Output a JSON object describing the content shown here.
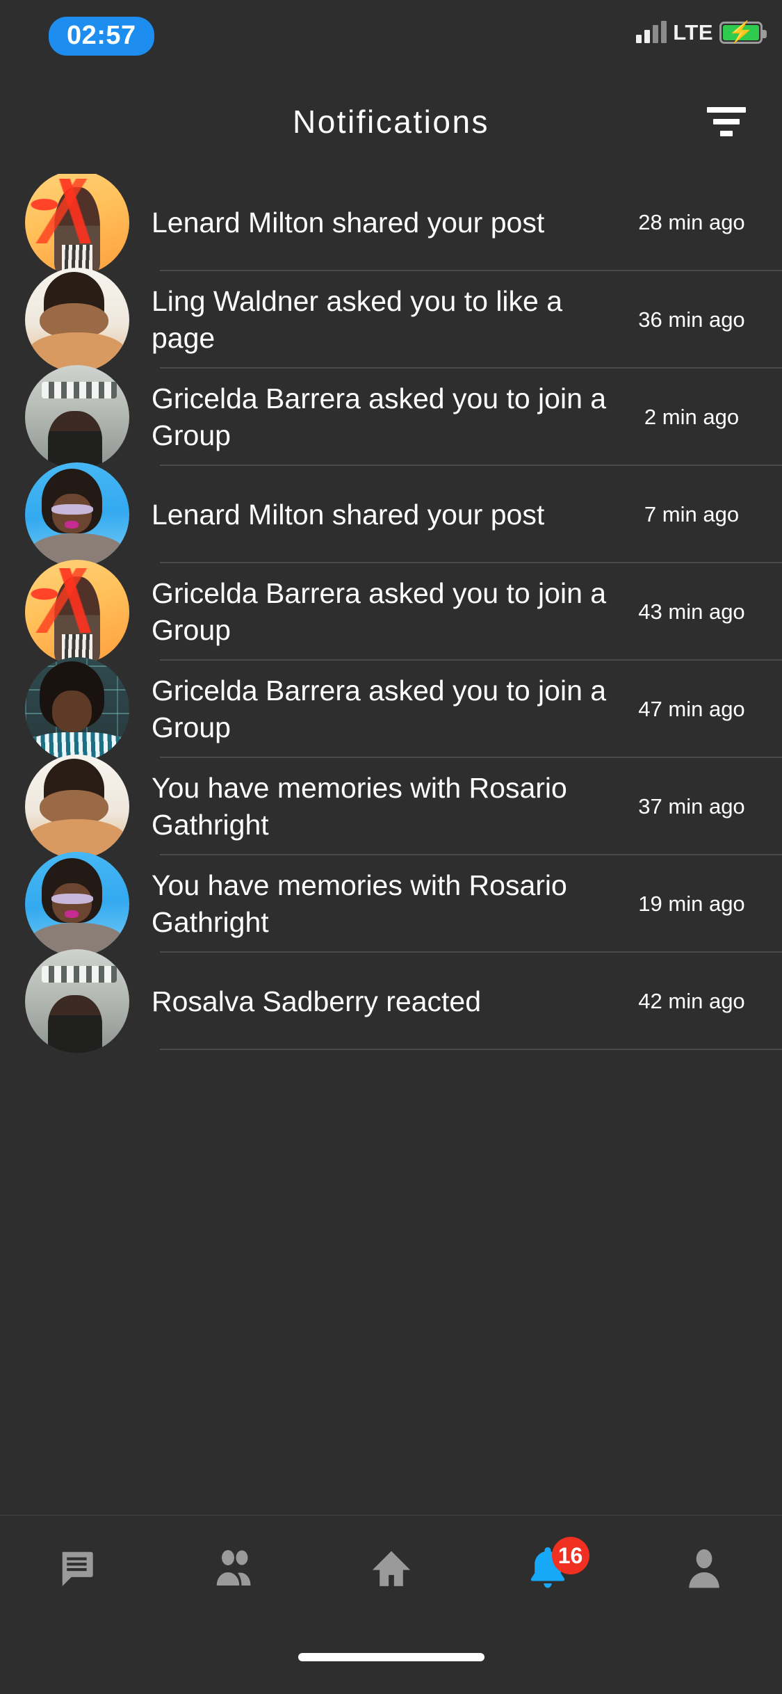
{
  "status_bar": {
    "recording_time": "02:57",
    "network_label": "LTE",
    "signal_icon": "signal-bars-icon",
    "battery_icon": "battery-charging-icon",
    "battery_charging_glyph": "⚡",
    "accent_blue": "#1d8df0",
    "battery_green": "#2ecb4e"
  },
  "header": {
    "title": "Notifications",
    "filter_icon": "filter-icon"
  },
  "notifications": [
    {
      "text": "Lenard Milton shared your post",
      "time": "28 min ago",
      "avatar": "av-graffiti"
    },
    {
      "text": "Ling Waldner asked you to like a page",
      "time": "36 min ago",
      "avatar": "av-cream"
    },
    {
      "text": "Gricelda Barrera asked you to join a Group",
      "time": "2 min ago",
      "avatar": "av-station"
    },
    {
      "text": "Lenard Milton shared your post",
      "time": "7 min ago",
      "avatar": "av-blue"
    },
    {
      "text": "Gricelda Barrera asked you to join a Group",
      "time": "43 min ago",
      "avatar": "av-graffiti"
    },
    {
      "text": "Gricelda Barrera asked you to join a Group",
      "time": "47 min ago",
      "avatar": "av-brick"
    },
    {
      "text": "You have memories with Rosario Gathright",
      "time": "37 min ago",
      "avatar": "av-cream"
    },
    {
      "text": "You have memories with Rosario Gathright",
      "time": "19 min ago",
      "avatar": "av-blue"
    },
    {
      "text": "Rosalva Sadberry reacted",
      "time": "42 min ago",
      "avatar": "av-station"
    }
  ],
  "tabbar": {
    "items": [
      {
        "name": "tab-messages",
        "icon": "chat-bubble-icon",
        "active": false,
        "badge": ""
      },
      {
        "name": "tab-friends",
        "icon": "people-icon",
        "active": false,
        "badge": ""
      },
      {
        "name": "tab-home",
        "icon": "home-icon",
        "active": false,
        "badge": ""
      },
      {
        "name": "tab-notifications",
        "icon": "bell-icon",
        "active": true,
        "badge": "16"
      },
      {
        "name": "tab-profile",
        "icon": "person-icon",
        "active": false,
        "badge": ""
      }
    ],
    "active_color": "#17a9f7",
    "inactive_color": "#9a9a9a",
    "badge_color": "#f03122"
  },
  "home_indicator": "home-indicator"
}
